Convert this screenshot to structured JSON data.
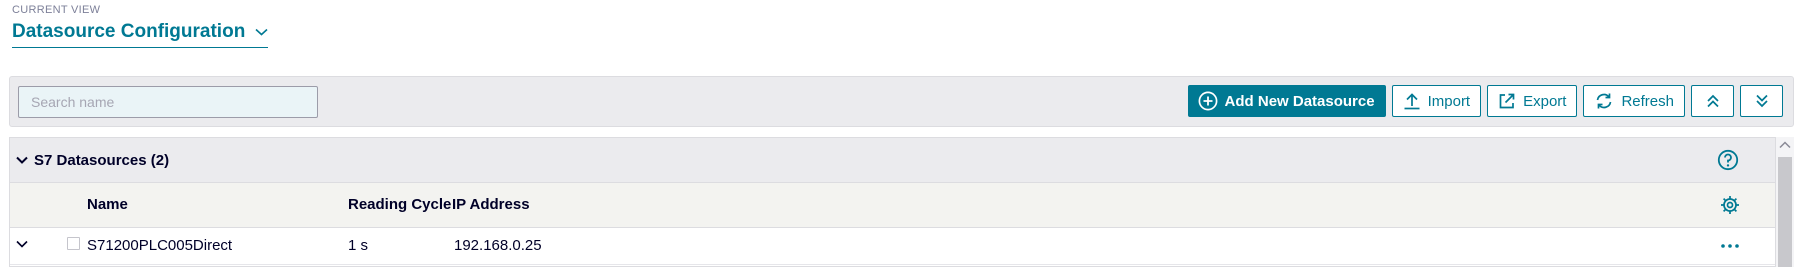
{
  "view": {
    "caption": "CURRENT VIEW",
    "title": "Datasource Configuration"
  },
  "toolbar": {
    "search_placeholder": "Search name",
    "search_value": "",
    "add_label": "Add New Datasource",
    "import_label": "Import",
    "export_label": "Export",
    "refresh_label": "Refresh"
  },
  "group": {
    "title": "S7 Datasources (2)"
  },
  "table": {
    "columns": {
      "name": "Name",
      "reading_cycle": "Reading Cycle",
      "ip_address": "IP Address"
    },
    "rows": [
      {
        "name": "S71200PLC005Direct",
        "reading_cycle": "1 s",
        "ip_address": "192.168.0.25"
      }
    ]
  },
  "icons": {
    "view_dropdown": "chevron-down-icon",
    "add": "plus-circle-icon",
    "import": "upload-icon",
    "export": "export-icon",
    "refresh": "refresh-icon",
    "collapse_all": "double-chevron-up-icon",
    "expand_all": "double-chevron-down-icon",
    "group_toggle": "chevron-down-icon",
    "help": "help-circle-icon",
    "column_settings": "gear-icon",
    "row_expand": "chevron-down-icon",
    "row_menu": "more-horizontal-icon"
  },
  "colors": {
    "accent": "#007993",
    "toolbar_bg": "#ebebee",
    "table_header_bg": "#f3f3f0",
    "text": "#000028"
  }
}
